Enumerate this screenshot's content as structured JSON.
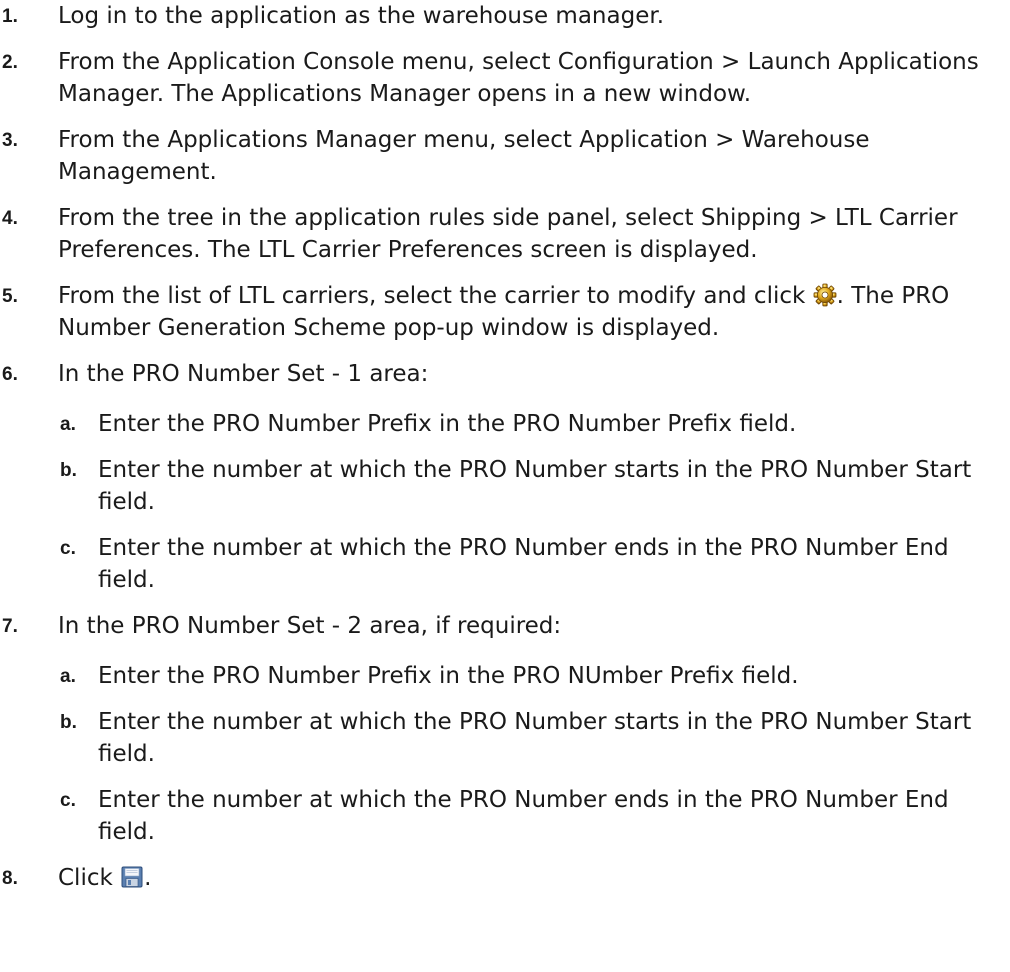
{
  "steps": [
    {
      "num": "1.",
      "text": "Log in to the application as the warehouse manager."
    },
    {
      "num": "2.",
      "text": "From the Application Console menu, select Configuration > Launch Applications Manager. The Applications Manager opens in a new window."
    },
    {
      "num": "3.",
      "text": "From the Applications Manager menu, select Application > Warehouse Management."
    },
    {
      "num": "4.",
      "text": "From the tree in the application rules side panel, select Shipping > LTL Carrier Preferences. The LTL Carrier Preferences screen is displayed."
    },
    {
      "num": "5.",
      "text_before": "From the list of LTL carriers, select the carrier to modify and click ",
      "icon": "gear-icon",
      "text_after": ". The PRO Number Generation Scheme pop-up window is displayed."
    },
    {
      "num": "6.",
      "text": "In the PRO Number Set - 1 area:",
      "subs": [
        {
          "num": "a.",
          "text": "Enter the PRO Number Prefix in the PRO Number Prefix field."
        },
        {
          "num": "b.",
          "text": "Enter the number at which the PRO Number starts in the PRO Number Start field."
        },
        {
          "num": "c.",
          "text": "Enter the number at which the PRO Number ends in the PRO Number End field."
        }
      ]
    },
    {
      "num": "7.",
      "text": "In the PRO Number Set - 2 area, if required:",
      "subs": [
        {
          "num": "a.",
          "text": "Enter the PRO Number Prefix in the PRO NUmber Prefix field."
        },
        {
          "num": "b.",
          "text": "Enter the number at which the PRO Number starts in the PRO Number Start field."
        },
        {
          "num": "c.",
          "text": "Enter the number at which the PRO Number ends in the PRO Number End field."
        }
      ]
    },
    {
      "num": "8.",
      "text_before": "Click ",
      "icon": "save-icon",
      "text_after": "."
    }
  ]
}
